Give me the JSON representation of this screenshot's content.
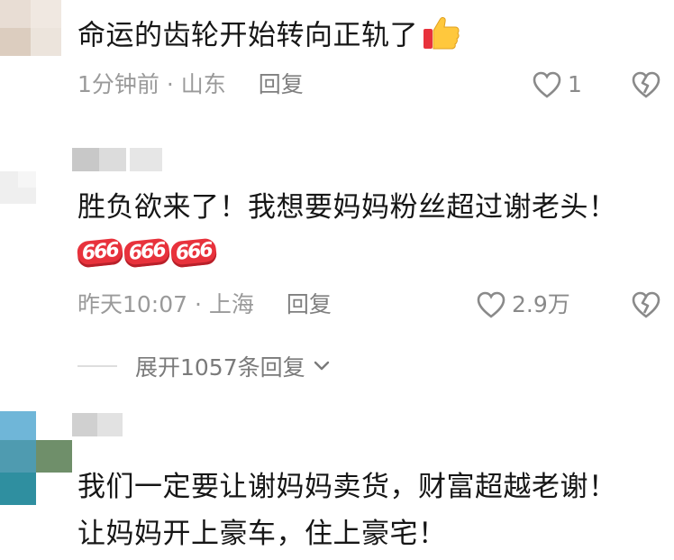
{
  "comments": [
    {
      "text": "命运的齿轮开始转向正轨了",
      "emoji": "thumbs-up",
      "time": "1分钟前",
      "location": "山东",
      "reply_label": "回复",
      "likes": "1"
    },
    {
      "text": "胜负欲来了！我想要妈妈粉丝超过谢老头！",
      "emoji_666": [
        "666",
        "666",
        "666"
      ],
      "time": "昨天10:07",
      "location": "上海",
      "reply_label": "回复",
      "likes": "2.9万",
      "expand_label": "展开1057条回复"
    },
    {
      "text_line1": "我们一定要让谢妈妈卖货，财富超越老谢！",
      "text_line2": "让妈妈开上豪车，住上豪宅！"
    }
  ],
  "separator": " · ",
  "icons": {
    "like": "heart-outline-icon",
    "dislike": "broken-heart-icon",
    "expand": "chevron-down-icon",
    "emoji": "thumbs-up-emoji"
  }
}
